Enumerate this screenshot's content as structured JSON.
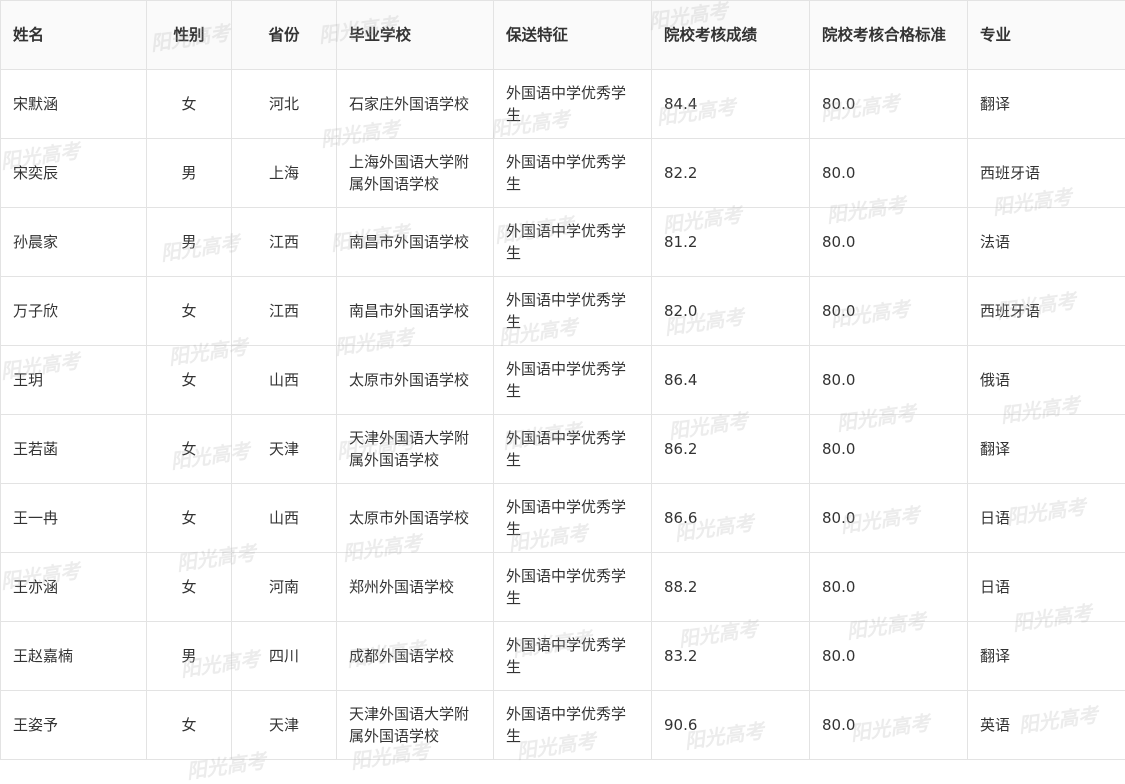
{
  "table": {
    "headers": [
      "姓名",
      "性别",
      "省份",
      "毕业学校",
      "保送特征",
      "院校考核成绩",
      "院校考核合格标准",
      "专业"
    ],
    "rows": [
      [
        "宋默涵",
        "女",
        "河北",
        "石家庄外国语学校",
        "外国语中学优秀学生",
        "84.4",
        "80.0",
        "翻译"
      ],
      [
        "宋奕辰",
        "男",
        "上海",
        "上海外国语大学附属外国语学校",
        "外国语中学优秀学生",
        "82.2",
        "80.0",
        "西班牙语"
      ],
      [
        "孙晨家",
        "男",
        "江西",
        "南昌市外国语学校",
        "外国语中学优秀学生",
        "81.2",
        "80.0",
        "法语"
      ],
      [
        "万子欣",
        "女",
        "江西",
        "南昌市外国语学校",
        "外国语中学优秀学生",
        "82.0",
        "80.0",
        "西班牙语"
      ],
      [
        "王玥",
        "女",
        "山西",
        "太原市外国语学校",
        "外国语中学优秀学生",
        "86.4",
        "80.0",
        "俄语"
      ],
      [
        "王若菡",
        "女",
        "天津",
        "天津外国语大学附属外国语学校",
        "外国语中学优秀学生",
        "86.2",
        "80.0",
        "翻译"
      ],
      [
        "王一冉",
        "女",
        "山西",
        "太原市外国语学校",
        "外国语中学优秀学生",
        "86.6",
        "80.0",
        "日语"
      ],
      [
        "王亦涵",
        "女",
        "河南",
        "郑州外国语学校",
        "外国语中学优秀学生",
        "88.2",
        "80.0",
        "日语"
      ],
      [
        "王赵嘉楠",
        "男",
        "四川",
        "成都外国语学校",
        "外国语中学优秀学生",
        "83.2",
        "80.0",
        "翻译"
      ],
      [
        "王姿予",
        "女",
        "天津",
        "天津外国语大学附属外国语学校",
        "外国语中学优秀学生",
        "90.6",
        "80.0",
        "英语"
      ]
    ]
  },
  "watermark": {
    "text": "阳光高考"
  },
  "colors": {
    "border": "#e3e3e3",
    "header_bg": "#fafafa",
    "text": "#333333"
  }
}
